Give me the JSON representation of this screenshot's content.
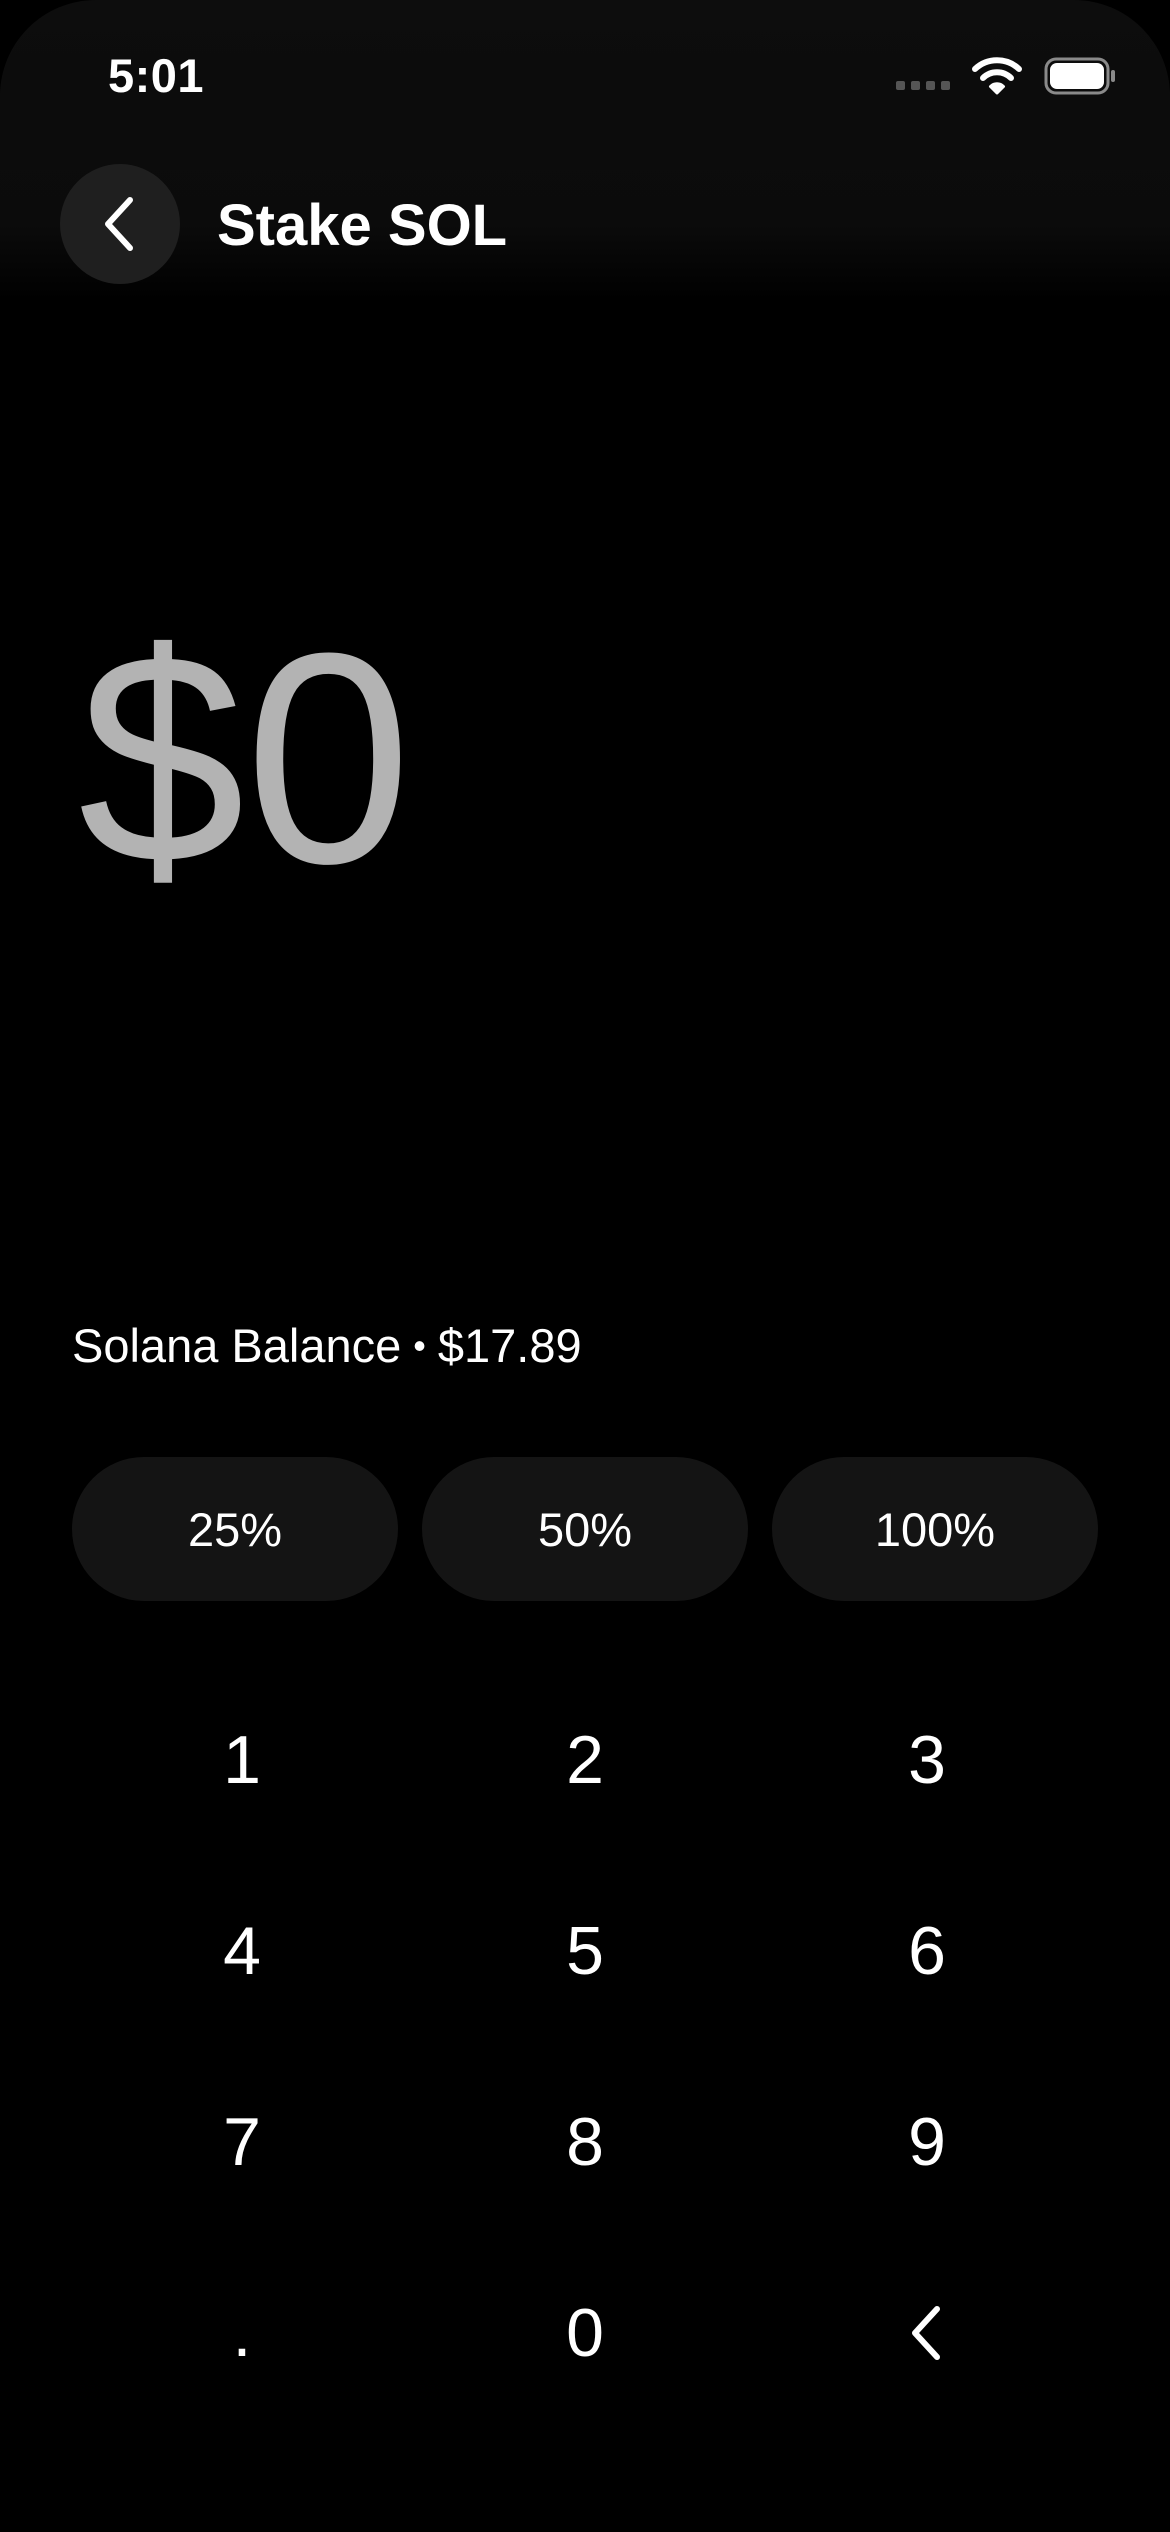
{
  "status_bar": {
    "time": "5:01"
  },
  "header": {
    "title": "Stake SOL",
    "back_icon": "chevron-left-icon"
  },
  "amount": {
    "display": "$0"
  },
  "balance": {
    "label": "Solana Balance",
    "separator": "•",
    "value": "$17.89"
  },
  "quick_amounts": [
    "25%",
    "50%",
    "100%"
  ],
  "keypad": {
    "keys": [
      "1",
      "2",
      "3",
      "4",
      "5",
      "6",
      "7",
      "8",
      "9",
      ".",
      "0"
    ],
    "backspace_icon": "chevron-left-icon"
  },
  "colors": {
    "background": "#000000",
    "amount_text": "#b3b3b3",
    "chip_background": "#141414",
    "back_button_background": "#1f1f1f"
  }
}
